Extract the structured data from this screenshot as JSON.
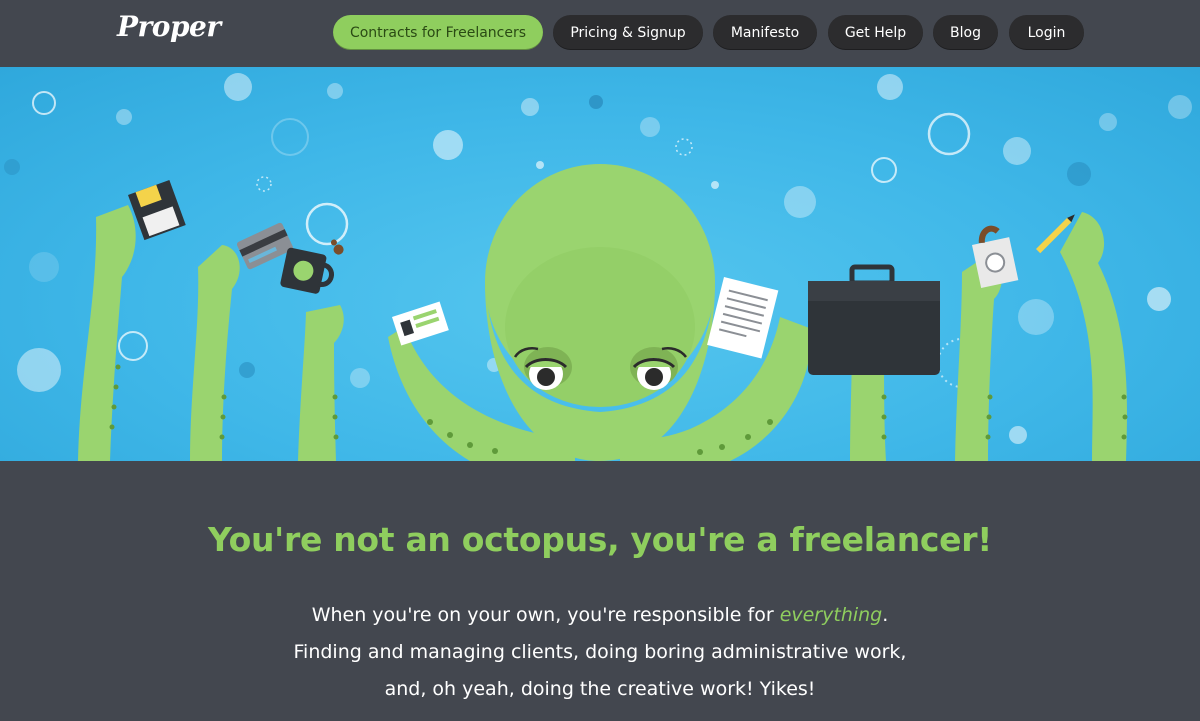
{
  "header": {
    "logo_text": "Proper",
    "nav": [
      {
        "label": "Contracts for Freelancers",
        "active": true
      },
      {
        "label": "Pricing & Signup",
        "active": false
      },
      {
        "label": "Manifesto",
        "active": false
      },
      {
        "label": "Get Help",
        "active": false
      },
      {
        "label": "Blog",
        "active": false
      },
      {
        "label": "Login",
        "active": false
      }
    ]
  },
  "hero": {
    "illustration": "octopus-juggling-freelance-tasks",
    "items": [
      "floppy-disk-icon",
      "credit-card-icon",
      "coffee-mug-icon",
      "business-card-icon",
      "document-icon",
      "briefcase-icon",
      "coffee-cup-icon",
      "pencil-icon"
    ]
  },
  "main": {
    "headline": "You're not an octopus, you're a freelancer!",
    "line1_before": "When you're on your own, you're responsible for ",
    "line1_emphasis": "everything",
    "line1_after": ".",
    "line2": "Finding and managing clients, doing boring administrative work,",
    "line3": "and, oh yeah, doing the creative work! Yikes!"
  },
  "colors": {
    "accent_green": "#8fce5e",
    "header_bg": "#43474f",
    "nav_pill": "#2c2c2e",
    "sky_blue": "#3fb7e8",
    "octopus_green": "#9ad46f"
  }
}
